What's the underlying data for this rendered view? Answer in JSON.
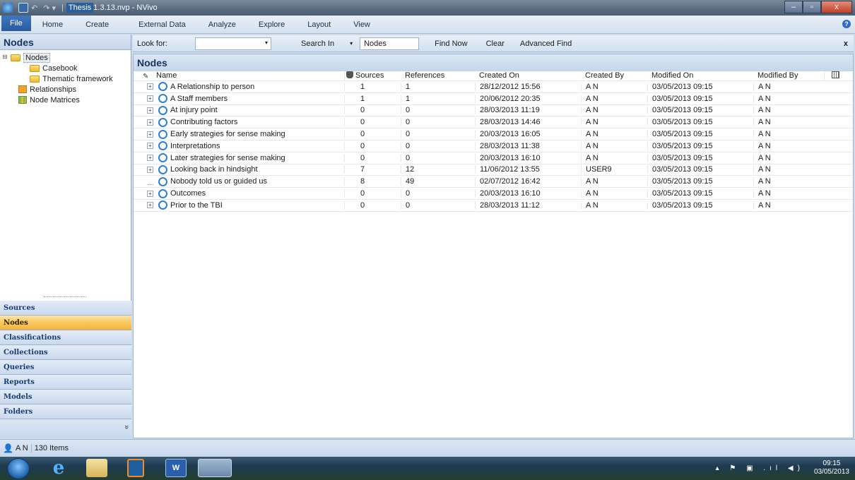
{
  "window": {
    "title_file": "Thesis",
    "title_rest": " 1.3.13.nvp - NVivo",
    "minimize": "–",
    "maximize": "▫",
    "close": "x"
  },
  "ribbon": {
    "file_tab": "File",
    "tabs": [
      "Home",
      "Create",
      "External Data",
      "Analyze",
      "Explore",
      "Layout",
      "View"
    ],
    "help": "?"
  },
  "nav": {
    "header": "Nodes",
    "tree": [
      {
        "label": "Nodes",
        "level": 0,
        "icon": "open-folder-icon",
        "expander": "⊟",
        "selected": true
      },
      {
        "label": "Casebook",
        "level": 1,
        "icon": "folder-icon"
      },
      {
        "label": "Thematic framework",
        "level": 1,
        "icon": "folder-icon"
      },
      {
        "label": "Relationships",
        "level": 0,
        "icon": "relationships-icon"
      },
      {
        "label": "Node Matrices",
        "level": 0,
        "icon": "node-matrices-icon"
      }
    ],
    "buttons": [
      "Sources",
      "Nodes",
      "Classifications",
      "Collections",
      "Queries",
      "Reports",
      "Models",
      "Folders"
    ],
    "active_button": "Nodes",
    "footer_chevron": "»"
  },
  "findbar": {
    "look_for_label": "Look for:",
    "look_for_value": "",
    "search_in_label": "Search In",
    "search_in_value": "Nodes",
    "find_now": "Find Now",
    "clear": "Clear",
    "advanced_find": "Advanced Find",
    "close": "x"
  },
  "panel": {
    "title": "Nodes",
    "columns": [
      "Name",
      "Sources",
      "References",
      "Created On",
      "Created By",
      "Modified On",
      "Modified By"
    ],
    "rows": [
      {
        "name": "A Relationship to person",
        "sources": "1",
        "references": "1",
        "created_on": "28/12/2012 15:56",
        "created_by": "A N",
        "modified_on": "03/05/2013 09:15",
        "modified_by": "A N",
        "expandable": true
      },
      {
        "name": "A Staff members",
        "sources": "1",
        "references": "1",
        "created_on": "20/06/2012 20:35",
        "created_by": "A N",
        "modified_on": "03/05/2013 09:15",
        "modified_by": "A N",
        "expandable": true
      },
      {
        "name": "At injury point",
        "sources": "0",
        "references": "0",
        "created_on": "28/03/2013 11:19",
        "created_by": "A N",
        "modified_on": "03/05/2013 09:15",
        "modified_by": "A N",
        "expandable": true
      },
      {
        "name": "Contributing factors",
        "sources": "0",
        "references": "0",
        "created_on": "28/03/2013 14:46",
        "created_by": "A N",
        "modified_on": "03/05/2013 09:15",
        "modified_by": "A N",
        "expandable": true
      },
      {
        "name": "Early strategies for sense making",
        "sources": "0",
        "references": "0",
        "created_on": "20/03/2013 16:05",
        "created_by": "A N",
        "modified_on": "03/05/2013 09:15",
        "modified_by": "A N",
        "expandable": true
      },
      {
        "name": "Interpretations",
        "sources": "0",
        "references": "0",
        "created_on": "28/03/2013 11:38",
        "created_by": "A N",
        "modified_on": "03/05/2013 09:15",
        "modified_by": "A N",
        "expandable": true
      },
      {
        "name": "Later strategies for sense making",
        "sources": "0",
        "references": "0",
        "created_on": "20/03/2013 16:10",
        "created_by": "A N",
        "modified_on": "03/05/2013 09:15",
        "modified_by": "A N",
        "expandable": true
      },
      {
        "name": "Looking back in hindsight",
        "sources": "7",
        "references": "12",
        "created_on": "11/06/2012 13:55",
        "created_by": "USER9",
        "modified_on": "03/05/2013 09:15",
        "modified_by": "A N",
        "expandable": true
      },
      {
        "name": "Nobody told us or guided us",
        "sources": "8",
        "references": "49",
        "created_on": "02/07/2012 16:42",
        "created_by": "A N",
        "modified_on": "03/05/2013 09:15",
        "modified_by": "A N",
        "expandable": false
      },
      {
        "name": "Outcomes",
        "sources": "0",
        "references": "0",
        "created_on": "20/03/2013 16:10",
        "created_by": "A N",
        "modified_on": "03/05/2013 09:15",
        "modified_by": "A N",
        "expandable": true
      },
      {
        "name": "Prior to the TBI",
        "sources": "0",
        "references": "0",
        "created_on": "28/03/2013 11:12",
        "created_by": "A N",
        "modified_on": "03/05/2013 09:15",
        "modified_by": "A N",
        "expandable": true
      }
    ]
  },
  "status": {
    "user": "A N",
    "items": "130 Items"
  },
  "taskbar": {
    "apps": [
      "internet-explorer-icon",
      "file-explorer-icon",
      "media-player-icon",
      "word-icon",
      "nvivo-icon"
    ],
    "word_letter": "W",
    "ie_letter": "e",
    "time": "09:15",
    "date": "03/05/2013",
    "tray_symbols": "▴ ⚑ ▣ .ıl ◀)"
  },
  "colors": {
    "accent": "#2d6bc4",
    "active_nav": "#f9c55b",
    "node_circle": "#2d7fd8"
  }
}
